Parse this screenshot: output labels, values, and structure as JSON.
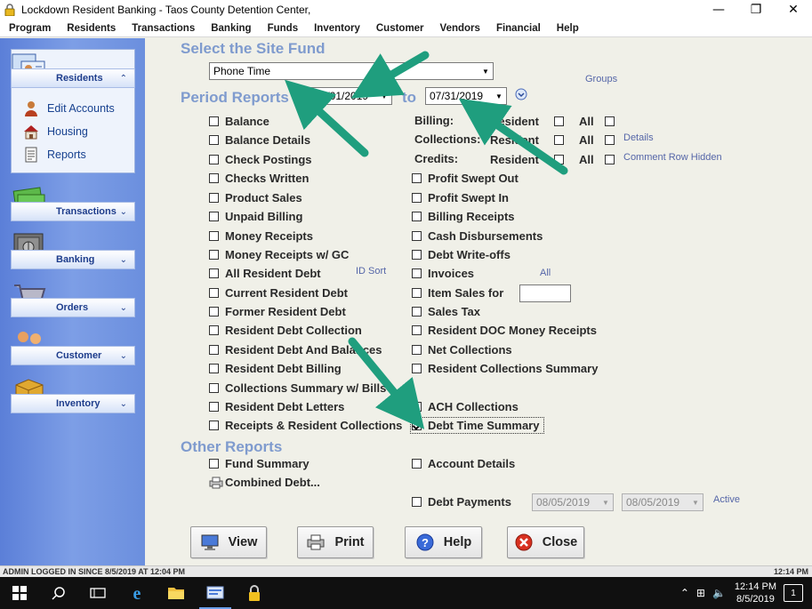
{
  "window": {
    "title": "Lockdown Resident Banking - Taos County Detention Center,",
    "minimize": "—",
    "restore": "❐",
    "close": "✕"
  },
  "menu": [
    "Program",
    "Residents",
    "Transactions",
    "Banking",
    "Funds",
    "Inventory",
    "Customer",
    "Vendors",
    "Financial",
    "Help"
  ],
  "sidebar": {
    "residents": {
      "label": "Residents",
      "chevron": "⌃",
      "items": [
        {
          "label": "Edit Accounts",
          "icon": "person-icon"
        },
        {
          "label": "Housing",
          "icon": "house-icon"
        },
        {
          "label": "Reports",
          "icon": "report-icon"
        }
      ]
    },
    "groups": [
      {
        "label": "Transactions",
        "icon": "money-icon",
        "chevron": "⌄"
      },
      {
        "label": "Banking",
        "icon": "safe-icon",
        "chevron": "⌄"
      },
      {
        "label": "Orders",
        "icon": "cart-icon",
        "chevron": "⌄"
      },
      {
        "label": "Customer",
        "icon": "people-icon",
        "chevron": "⌄"
      },
      {
        "label": "Inventory",
        "icon": "box-icon",
        "chevron": "⌄"
      }
    ]
  },
  "site_fund": {
    "title": "Select the Site Fund",
    "value": "Phone Time",
    "groups_label": "Groups"
  },
  "period": {
    "title": "Period Reports",
    "from": "07/01/2019",
    "to_label": "to",
    "to": "07/31/2019"
  },
  "billing": {
    "billing_label": "Billing:",
    "collections_label": "Collections:",
    "credits_label": "Credits:",
    "resident_label": "Resident",
    "all_label": "All",
    "details_label": "Details",
    "comment_label": "Comment Row Hidden"
  },
  "left_reports": [
    {
      "label": "Balance",
      "checked": false
    },
    {
      "label": "Balance Details",
      "checked": false
    },
    {
      "label": "Check Postings",
      "checked": false
    },
    {
      "label": "Checks Written",
      "checked": false
    },
    {
      "label": "Product Sales",
      "checked": false
    },
    {
      "label": "Unpaid Billing",
      "checked": false
    },
    {
      "label": "Money Receipts",
      "checked": false
    },
    {
      "label": "Money Receipts w/ GC",
      "checked": false
    },
    {
      "label": "All Resident Debt",
      "checked": false
    },
    {
      "label": "Current Resident Debt",
      "checked": false
    },
    {
      "label": "Former Resident Debt",
      "checked": false
    },
    {
      "label": "Resident Debt Collection",
      "checked": false
    },
    {
      "label": "Resident Debt And Balances",
      "checked": false
    },
    {
      "label": "Resident Debt Billing",
      "checked": false
    },
    {
      "label": "Collections Summary w/ Bills",
      "checked": false
    },
    {
      "label": "Resident Debt Letters",
      "checked": false
    },
    {
      "label": "Receipts & Resident Collections",
      "checked": false
    }
  ],
  "right_reports": [
    {
      "label": "Profit Swept Out",
      "checked": false
    },
    {
      "label": "Profit Swept In",
      "checked": false
    },
    {
      "label": "Billing Receipts",
      "checked": false
    },
    {
      "label": "Cash Disbursements",
      "checked": false
    },
    {
      "label": "Debt Write-offs",
      "checked": false
    },
    {
      "label": "Invoices",
      "checked": false
    },
    {
      "label": "Item Sales for",
      "checked": false
    },
    {
      "label": "Sales Tax",
      "checked": false
    },
    {
      "label": "Resident DOC Money Receipts",
      "checked": false
    },
    {
      "label": "Net Collections",
      "checked": false
    },
    {
      "label": "Resident Collections Summary",
      "checked": false
    },
    {
      "label": "ACH Collections",
      "checked": false
    },
    {
      "label": "Debt Time Summary",
      "checked": true
    }
  ],
  "id_sort_label": "ID Sort",
  "all_invoices_label": "All",
  "other": {
    "title": "Other Reports",
    "fund_summary": "Fund Summary",
    "combined_debt": "Combined Debt...",
    "account_details": "Account Details",
    "debt_payments": "Debt Payments",
    "date1": "08/05/2019",
    "date2": "08/05/2019",
    "active_label": "Active"
  },
  "buttons": {
    "view": "View",
    "print": "Print",
    "help": "Help",
    "close": "Close"
  },
  "status": {
    "left": "ADMIN LOGGED IN SINCE 8/5/2019 AT 12:04 PM",
    "right": "12:14 PM"
  },
  "taskbar": {
    "time": "12:14 PM",
    "date": "8/5/2019",
    "notifications": "1"
  },
  "colors": {
    "accent_arrow": "#1f9e7e",
    "section_title": "#7f9bce",
    "sidebar": "#6b8fde"
  }
}
